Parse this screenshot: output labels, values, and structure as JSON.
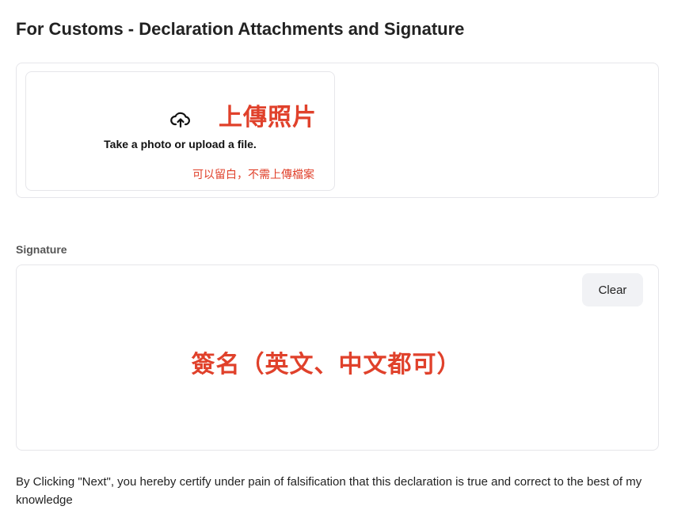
{
  "page": {
    "title": "For Customs - Declaration Attachments and Signature"
  },
  "attachments": {
    "icon": "cloud-upload-icon",
    "annotation": "上傳照片",
    "upload_text": "Take a photo or upload a file.",
    "note": "可以留白，不需上傳檔案"
  },
  "signature": {
    "label": "Signature",
    "clear_label": "Clear",
    "annotation": "簽名（英文、中文都可）"
  },
  "certification": {
    "text": "By Clicking \"Next\", you hereby certify under pain of falsification that this declaration is true and correct to the best of my knowledge"
  },
  "colors": {
    "annotation": "#e0412b",
    "border": "#e6e6ea",
    "clear_bg": "#f1f2f5"
  }
}
